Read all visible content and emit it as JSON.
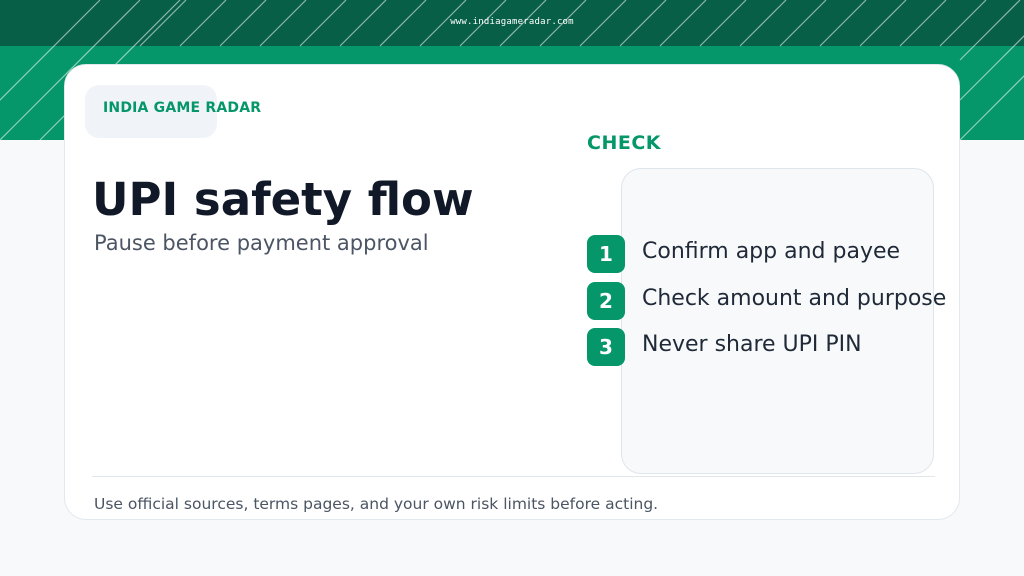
{
  "site": {
    "url": "www.indiagameradar.com"
  },
  "brand": {
    "name": "INDIA GAME RADAR"
  },
  "hero": {
    "title": "UPI safety flow",
    "subtitle": "Pause before payment approval"
  },
  "check": {
    "heading": "CHECK",
    "steps": [
      {
        "number": "1",
        "text": "Confirm app and payee"
      },
      {
        "number": "2",
        "text": "Check amount and purpose"
      },
      {
        "number": "3",
        "text": "Never share UPI PIN"
      }
    ]
  },
  "footer": {
    "note": "Use official sources, terms pages, and your own risk limits before acting."
  },
  "colors": {
    "accent": "#059669",
    "accent_dark": "#065f46",
    "title": "#111827",
    "muted": "#4b5563"
  }
}
